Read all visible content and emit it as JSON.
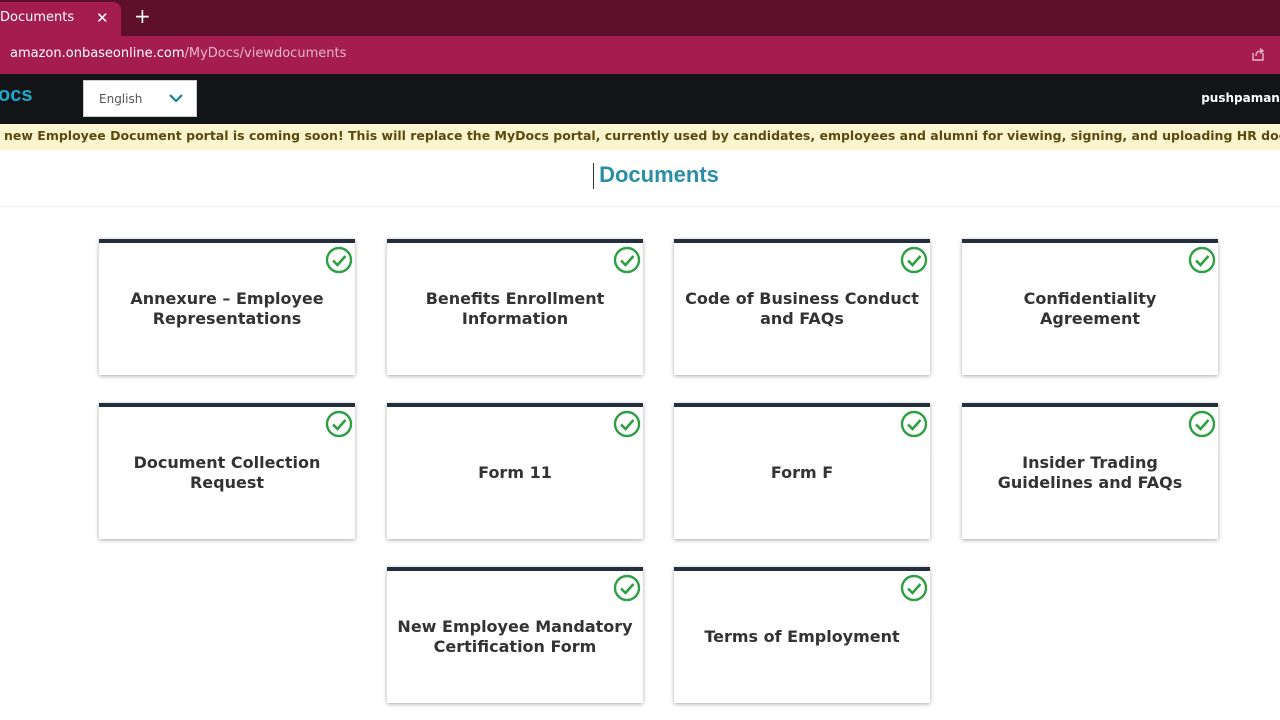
{
  "browser": {
    "tab_title": "Documents",
    "close_glyph": "✕",
    "new_tab_glyph": "+",
    "url_host": "amazon.onbaseonline.com",
    "url_path": "/MyDocs/viewdocuments"
  },
  "header": {
    "logo": "ocs",
    "language": "English",
    "username": "pushpamane"
  },
  "banner": {
    "text": "new Employee Document portal is coming soon! This will replace the MyDocs portal, currently used by candidates, employees and alumni for viewing, signing, and uploading HR documents."
  },
  "page": {
    "title": "Documents"
  },
  "documents": [
    {
      "label": "Annexure – Employee Representations",
      "status": "completed"
    },
    {
      "label": "Benefits Enrollment Information",
      "status": "completed"
    },
    {
      "label": "Code of Business Conduct and FAQs",
      "status": "completed"
    },
    {
      "label": "Confidentiality Agreement",
      "status": "completed"
    },
    {
      "label": "Document Collection Request",
      "status": "completed"
    },
    {
      "label": "Form 11",
      "status": "completed"
    },
    {
      "label": "Form F",
      "status": "completed"
    },
    {
      "label": "Insider Trading Guidelines and FAQs",
      "status": "completed"
    },
    {
      "label": "New Employee Mandatory Certification Form",
      "status": "completed"
    },
    {
      "label": "Terms of Employment",
      "status": "completed"
    }
  ],
  "colors": {
    "tabstrip": "#5e0f2a",
    "addressbar": "#a51d4e",
    "header": "#121418",
    "accent": "#2a8ea6",
    "check": "#2ea043",
    "banner": "#fcf4cf"
  },
  "icons": {
    "status": "check-circle-icon",
    "share": "share-icon",
    "dropdown": "chevron-down-icon"
  }
}
